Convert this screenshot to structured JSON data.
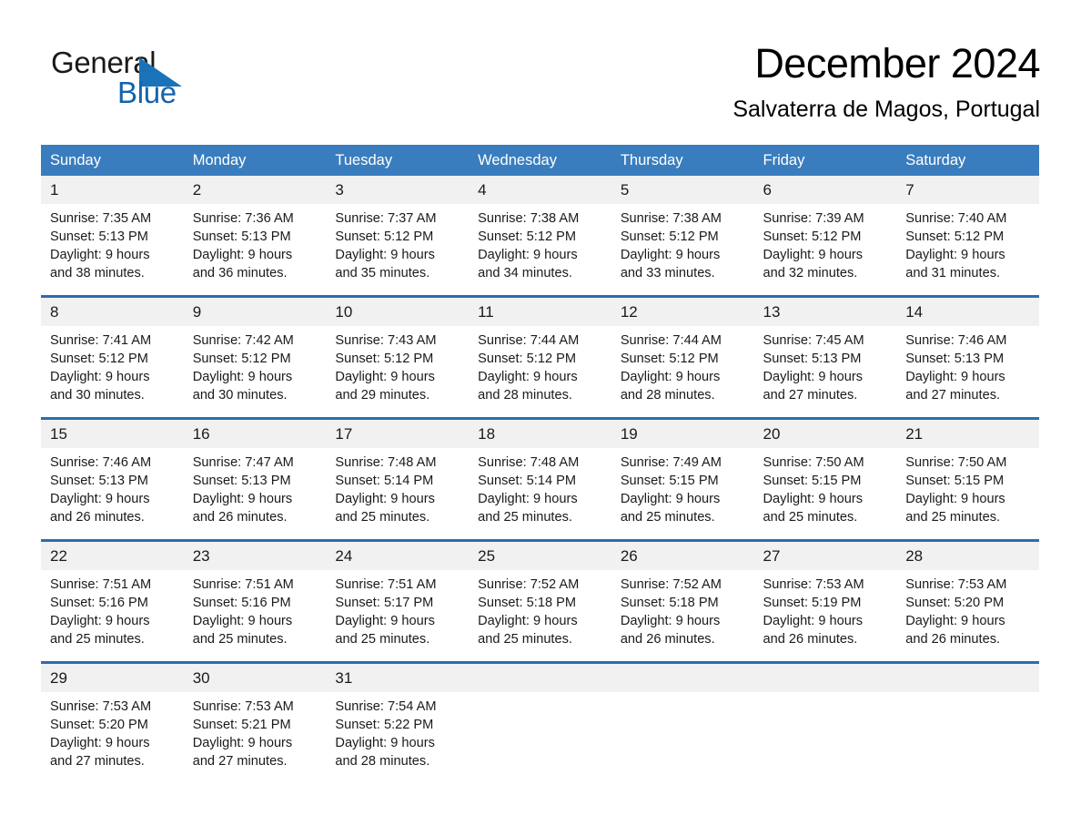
{
  "brand": {
    "line1": "General",
    "line2": "Blue",
    "triangle_icon": "general-blue-triangle-icon",
    "accent_color": "#1464ab"
  },
  "header": {
    "title": "December 2024",
    "subtitle": "Salvaterra de Magos, Portugal"
  },
  "theme": {
    "header_blue": "#3a7dbe",
    "row_rule_blue": "#2a6db0",
    "daynum_bg": "#f1f1f1"
  },
  "weekday_headers": [
    "Sunday",
    "Monday",
    "Tuesday",
    "Wednesday",
    "Thursday",
    "Friday",
    "Saturday"
  ],
  "weeks": [
    [
      {
        "day": "1",
        "sunrise": "Sunrise: 7:35 AM",
        "sunset": "Sunset: 5:13 PM",
        "daylight1": "Daylight: 9 hours",
        "daylight2": "and 38 minutes."
      },
      {
        "day": "2",
        "sunrise": "Sunrise: 7:36 AM",
        "sunset": "Sunset: 5:13 PM",
        "daylight1": "Daylight: 9 hours",
        "daylight2": "and 36 minutes."
      },
      {
        "day": "3",
        "sunrise": "Sunrise: 7:37 AM",
        "sunset": "Sunset: 5:12 PM",
        "daylight1": "Daylight: 9 hours",
        "daylight2": "and 35 minutes."
      },
      {
        "day": "4",
        "sunrise": "Sunrise: 7:38 AM",
        "sunset": "Sunset: 5:12 PM",
        "daylight1": "Daylight: 9 hours",
        "daylight2": "and 34 minutes."
      },
      {
        "day": "5",
        "sunrise": "Sunrise: 7:38 AM",
        "sunset": "Sunset: 5:12 PM",
        "daylight1": "Daylight: 9 hours",
        "daylight2": "and 33 minutes."
      },
      {
        "day": "6",
        "sunrise": "Sunrise: 7:39 AM",
        "sunset": "Sunset: 5:12 PM",
        "daylight1": "Daylight: 9 hours",
        "daylight2": "and 32 minutes."
      },
      {
        "day": "7",
        "sunrise": "Sunrise: 7:40 AM",
        "sunset": "Sunset: 5:12 PM",
        "daylight1": "Daylight: 9 hours",
        "daylight2": "and 31 minutes."
      }
    ],
    [
      {
        "day": "8",
        "sunrise": "Sunrise: 7:41 AM",
        "sunset": "Sunset: 5:12 PM",
        "daylight1": "Daylight: 9 hours",
        "daylight2": "and 30 minutes."
      },
      {
        "day": "9",
        "sunrise": "Sunrise: 7:42 AM",
        "sunset": "Sunset: 5:12 PM",
        "daylight1": "Daylight: 9 hours",
        "daylight2": "and 30 minutes."
      },
      {
        "day": "10",
        "sunrise": "Sunrise: 7:43 AM",
        "sunset": "Sunset: 5:12 PM",
        "daylight1": "Daylight: 9 hours",
        "daylight2": "and 29 minutes."
      },
      {
        "day": "11",
        "sunrise": "Sunrise: 7:44 AM",
        "sunset": "Sunset: 5:12 PM",
        "daylight1": "Daylight: 9 hours",
        "daylight2": "and 28 minutes."
      },
      {
        "day": "12",
        "sunrise": "Sunrise: 7:44 AM",
        "sunset": "Sunset: 5:12 PM",
        "daylight1": "Daylight: 9 hours",
        "daylight2": "and 28 minutes."
      },
      {
        "day": "13",
        "sunrise": "Sunrise: 7:45 AM",
        "sunset": "Sunset: 5:13 PM",
        "daylight1": "Daylight: 9 hours",
        "daylight2": "and 27 minutes."
      },
      {
        "day": "14",
        "sunrise": "Sunrise: 7:46 AM",
        "sunset": "Sunset: 5:13 PM",
        "daylight1": "Daylight: 9 hours",
        "daylight2": "and 27 minutes."
      }
    ],
    [
      {
        "day": "15",
        "sunrise": "Sunrise: 7:46 AM",
        "sunset": "Sunset: 5:13 PM",
        "daylight1": "Daylight: 9 hours",
        "daylight2": "and 26 minutes."
      },
      {
        "day": "16",
        "sunrise": "Sunrise: 7:47 AM",
        "sunset": "Sunset: 5:13 PM",
        "daylight1": "Daylight: 9 hours",
        "daylight2": "and 26 minutes."
      },
      {
        "day": "17",
        "sunrise": "Sunrise: 7:48 AM",
        "sunset": "Sunset: 5:14 PM",
        "daylight1": "Daylight: 9 hours",
        "daylight2": "and 25 minutes."
      },
      {
        "day": "18",
        "sunrise": "Sunrise: 7:48 AM",
        "sunset": "Sunset: 5:14 PM",
        "daylight1": "Daylight: 9 hours",
        "daylight2": "and 25 minutes."
      },
      {
        "day": "19",
        "sunrise": "Sunrise: 7:49 AM",
        "sunset": "Sunset: 5:15 PM",
        "daylight1": "Daylight: 9 hours",
        "daylight2": "and 25 minutes."
      },
      {
        "day": "20",
        "sunrise": "Sunrise: 7:50 AM",
        "sunset": "Sunset: 5:15 PM",
        "daylight1": "Daylight: 9 hours",
        "daylight2": "and 25 minutes."
      },
      {
        "day": "21",
        "sunrise": "Sunrise: 7:50 AM",
        "sunset": "Sunset: 5:15 PM",
        "daylight1": "Daylight: 9 hours",
        "daylight2": "and 25 minutes."
      }
    ],
    [
      {
        "day": "22",
        "sunrise": "Sunrise: 7:51 AM",
        "sunset": "Sunset: 5:16 PM",
        "daylight1": "Daylight: 9 hours",
        "daylight2": "and 25 minutes."
      },
      {
        "day": "23",
        "sunrise": "Sunrise: 7:51 AM",
        "sunset": "Sunset: 5:16 PM",
        "daylight1": "Daylight: 9 hours",
        "daylight2": "and 25 minutes."
      },
      {
        "day": "24",
        "sunrise": "Sunrise: 7:51 AM",
        "sunset": "Sunset: 5:17 PM",
        "daylight1": "Daylight: 9 hours",
        "daylight2": "and 25 minutes."
      },
      {
        "day": "25",
        "sunrise": "Sunrise: 7:52 AM",
        "sunset": "Sunset: 5:18 PM",
        "daylight1": "Daylight: 9 hours",
        "daylight2": "and 25 minutes."
      },
      {
        "day": "26",
        "sunrise": "Sunrise: 7:52 AM",
        "sunset": "Sunset: 5:18 PM",
        "daylight1": "Daylight: 9 hours",
        "daylight2": "and 26 minutes."
      },
      {
        "day": "27",
        "sunrise": "Sunrise: 7:53 AM",
        "sunset": "Sunset: 5:19 PM",
        "daylight1": "Daylight: 9 hours",
        "daylight2": "and 26 minutes."
      },
      {
        "day": "28",
        "sunrise": "Sunrise: 7:53 AM",
        "sunset": "Sunset: 5:20 PM",
        "daylight1": "Daylight: 9 hours",
        "daylight2": "and 26 minutes."
      }
    ],
    [
      {
        "day": "29",
        "sunrise": "Sunrise: 7:53 AM",
        "sunset": "Sunset: 5:20 PM",
        "daylight1": "Daylight: 9 hours",
        "daylight2": "and 27 minutes."
      },
      {
        "day": "30",
        "sunrise": "Sunrise: 7:53 AM",
        "sunset": "Sunset: 5:21 PM",
        "daylight1": "Daylight: 9 hours",
        "daylight2": "and 27 minutes."
      },
      {
        "day": "31",
        "sunrise": "Sunrise: 7:54 AM",
        "sunset": "Sunset: 5:22 PM",
        "daylight1": "Daylight: 9 hours",
        "daylight2": "and 28 minutes."
      },
      {
        "day": "",
        "sunrise": "",
        "sunset": "",
        "daylight1": "",
        "daylight2": ""
      },
      {
        "day": "",
        "sunrise": "",
        "sunset": "",
        "daylight1": "",
        "daylight2": ""
      },
      {
        "day": "",
        "sunrise": "",
        "sunset": "",
        "daylight1": "",
        "daylight2": ""
      },
      {
        "day": "",
        "sunrise": "",
        "sunset": "",
        "daylight1": "",
        "daylight2": ""
      }
    ]
  ]
}
